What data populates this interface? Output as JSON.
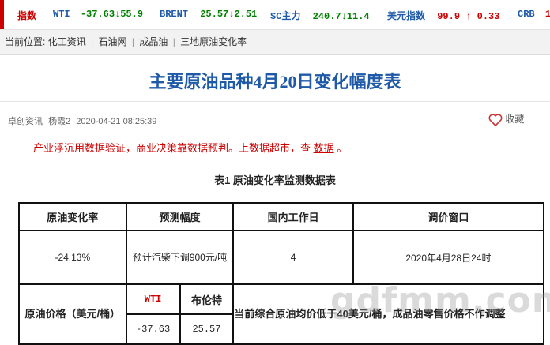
{
  "ticker": {
    "label": "指数",
    "items": [
      {
        "name": "WTI",
        "value": "-37.63",
        "arrow": "↓",
        "change": "55.9"
      },
      {
        "name": "BRENT",
        "value": "25.57",
        "arrow": "↓",
        "change": "2.51"
      },
      {
        "name": "SC主力",
        "value": "240.7",
        "arrow": "↓",
        "change": "11.4"
      },
      {
        "name": "美元指数",
        "value": "99.9",
        "arrow": "↑",
        "change": "0.33"
      },
      {
        "name": "CRB",
        "value": "1"
      }
    ]
  },
  "breadcrumb": {
    "prefix": "当前位置:",
    "items": [
      "化工资讯",
      "石油网",
      "成品油",
      "三地原油变化率"
    ],
    "sep": "|"
  },
  "article": {
    "title": "主要原油品种4月20日变化幅度表",
    "source": "卓创资讯",
    "author": "杨霞2",
    "datetime": "2020-04-21 08:25:39",
    "favorite": "收藏",
    "promo_text": "产业浮沉用数据验证，商业决策靠数据预判。上数据超市，查",
    "promo_link": "数据",
    "promo_end": "。",
    "table_caption": "表1   原油变化率监测数据表"
  },
  "table": {
    "headers": [
      "原油变化率",
      "预测幅度",
      "国内工作日",
      "调价窗口"
    ],
    "row1": [
      "-24.13%",
      "预计汽柴下调900元/吨",
      "4",
      "2020年4月28日24时"
    ],
    "price_label": "原油价格（美元/桶）",
    "price_cols": [
      "WTI",
      "布伦特"
    ],
    "price_vals": [
      "-37.63",
      "25.57"
    ],
    "note": "当前综合原油均价低于40美元/桶，成品油零售价格不作调整"
  },
  "watermark": "gdfmm.com",
  "colors": {
    "accent": "#1f5aa8",
    "red": "#cc0000",
    "green": "#008000"
  }
}
